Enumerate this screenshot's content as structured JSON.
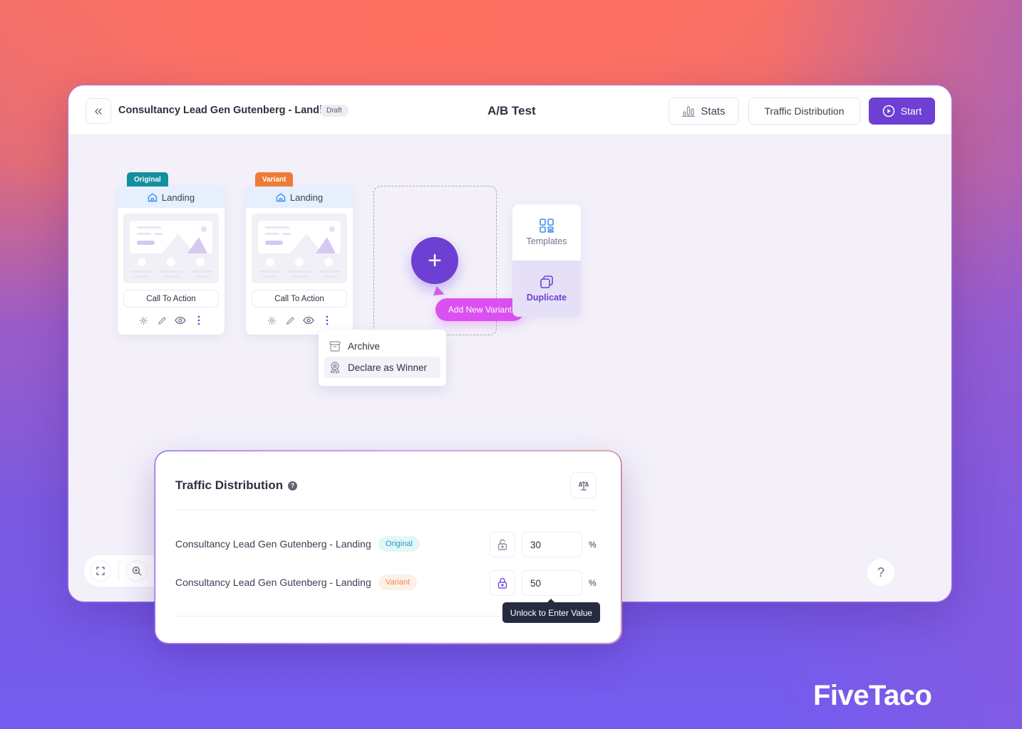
{
  "topbar": {
    "page_name": "Consultancy Lead Gen Gutenberg - Landing",
    "status_badge": "Draft",
    "title": "A/B Test",
    "stats_label": "Stats",
    "traffic_label": "Traffic Distribution",
    "start_label": "Start"
  },
  "cards": [
    {
      "tag": "Original",
      "tag_color": "#12909e",
      "header": "Landing",
      "cta": "Call To Action"
    },
    {
      "tag": "Variant",
      "tag_color": "#ee7b35",
      "header": "Landing",
      "cta": "Call To Action"
    }
  ],
  "add_variant": {
    "label": "Add New Variant"
  },
  "side_options": {
    "templates": "Templates",
    "duplicate": "Duplicate"
  },
  "context_menu": {
    "items": [
      "Archive",
      "Declare as Winner"
    ]
  },
  "help": {
    "label": "?"
  },
  "traffic_panel": {
    "title": "Traffic Distribution",
    "rows": [
      {
        "name": "Consultancy Lead Gen Gutenberg - Landing",
        "badge": "Original",
        "value": "30",
        "locked": false,
        "unit": "%"
      },
      {
        "name": "Consultancy Lead Gen Gutenberg - Landing",
        "badge": "Variant",
        "value": "50",
        "locked": true,
        "unit": "%"
      }
    ],
    "tooltip": "Unlock to Enter Value"
  },
  "brand": "FiveTaco",
  "colors": {
    "accent": "#6d3fd3",
    "pink": "#db50f0",
    "original": "#12909e",
    "variant": "#ee7b35"
  }
}
